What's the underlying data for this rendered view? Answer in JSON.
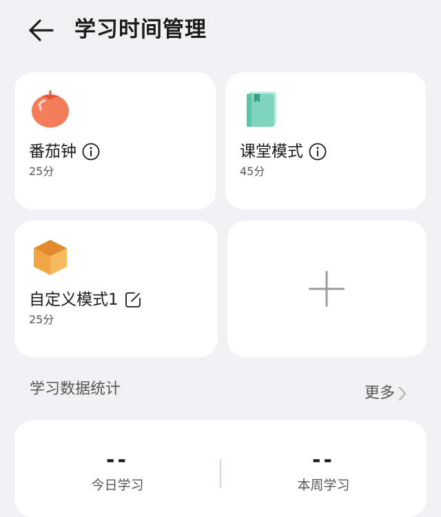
{
  "header": {
    "title": "学习时间管理"
  },
  "modes": [
    {
      "title": "番茄钟",
      "duration": "25分",
      "icon": "tomato-icon",
      "action_icon": "info-icon"
    },
    {
      "title": "课堂模式",
      "duration": "45分",
      "icon": "book-icon",
      "action_icon": "info-icon"
    },
    {
      "title": "自定义模式1",
      "duration": "25分",
      "icon": "box-icon",
      "action_icon": "edit-icon"
    }
  ],
  "add_card": {
    "icon": "plus-icon"
  },
  "stats_section": {
    "title": "学习数据统计",
    "more_label": "更多"
  },
  "stats": [
    {
      "label": "今日学习",
      "value": "--"
    },
    {
      "label": "本周学习",
      "value": "--"
    }
  ],
  "colors": {
    "background": "#f1f1f3",
    "card": "#ffffff",
    "tomato": "#f0704f",
    "book": "#7fd4bd",
    "box": "#f2a544",
    "plus": "#9a9a9a"
  }
}
